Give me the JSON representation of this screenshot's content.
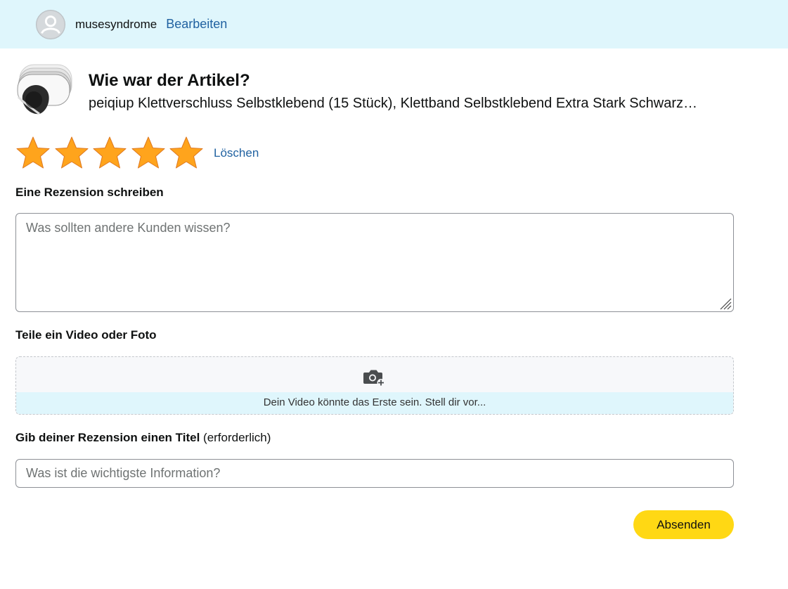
{
  "header": {
    "username": "musesyndrome",
    "edit_label": "Bearbeiten"
  },
  "product": {
    "question": "Wie war der Artikel?",
    "name": "peiqiup Klettverschluss Selbstklebend (15 Stück), Klettband Selbstklebend Extra Stark Schwarz…"
  },
  "rating": {
    "selected": 5,
    "max": 5,
    "star_color": "#ffa41c",
    "clear_label": "Löschen"
  },
  "review": {
    "label": "Eine Rezension schreiben",
    "placeholder": "Was sollten andere Kunden wissen?"
  },
  "media": {
    "label": "Teile ein Video oder Foto",
    "hint": "Dein Video könnte das Erste sein. Stell dir vor..."
  },
  "title": {
    "label": "Gib deiner Rezension einen Titel",
    "note": "(erforderlich)",
    "placeholder": "Was ist die wichtigste Information?"
  },
  "submit_label": "Absenden",
  "colors": {
    "accent_link": "#2162a1",
    "header_bg": "#dff6fc",
    "button_bg": "#ffd814"
  }
}
